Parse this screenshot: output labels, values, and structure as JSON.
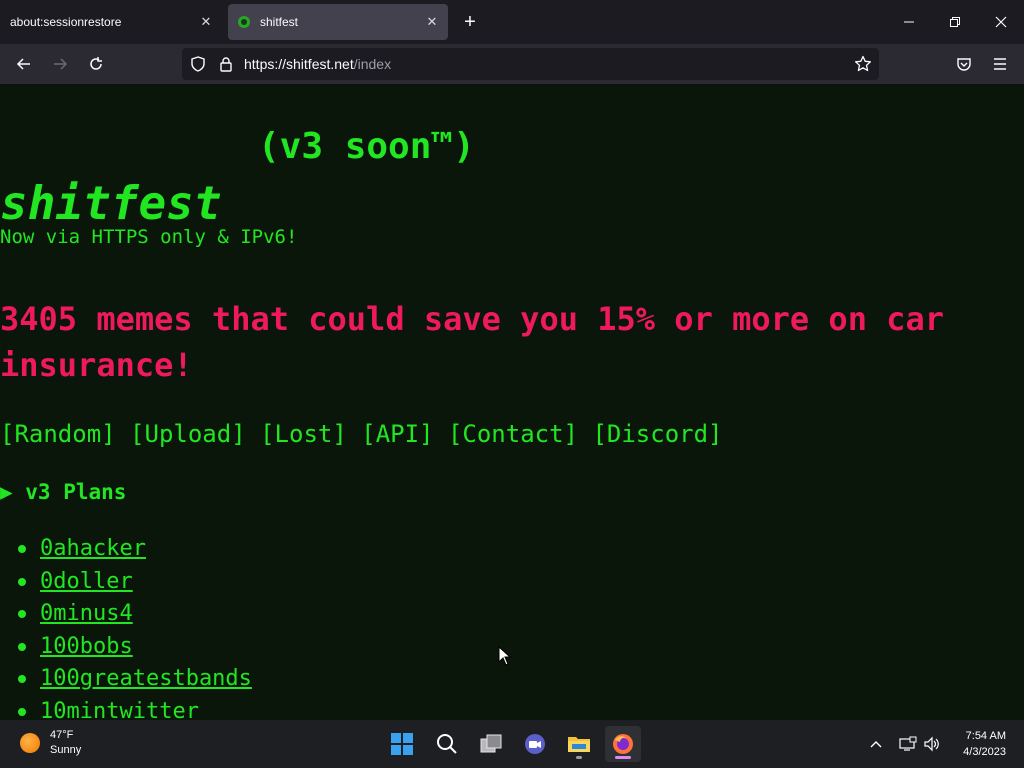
{
  "browser": {
    "tabs": [
      {
        "title": "about:sessionrestore"
      },
      {
        "title": "shitfest"
      }
    ],
    "url_host": "https://shitfest.net",
    "url_path": "/index"
  },
  "page": {
    "logo": "shitfest",
    "version_note": "(v3 soon™)",
    "tagline": "Now via HTTPS only & IPv6!",
    "headline": "3405 memes that could save you 15% or more on car insurance!",
    "nav_links": [
      "[Random]",
      "[Upload]",
      "[Lost]",
      "[API]",
      "[Contact]",
      "[Discord]"
    ],
    "details_summary": "▶ v3 Plans",
    "memes": [
      "0ahacker",
      "0doller",
      "0minus4",
      "100bobs",
      "100greatestbands",
      "10mintwitter"
    ]
  },
  "taskbar": {
    "weather_temp": "47°F",
    "weather_desc": "Sunny",
    "time": "7:54 AM",
    "date": "4/3/2023"
  },
  "colors": {
    "accent_green": "#22e622",
    "headline_pink": "#ee1a5c",
    "page_bg": "#0b160b"
  }
}
